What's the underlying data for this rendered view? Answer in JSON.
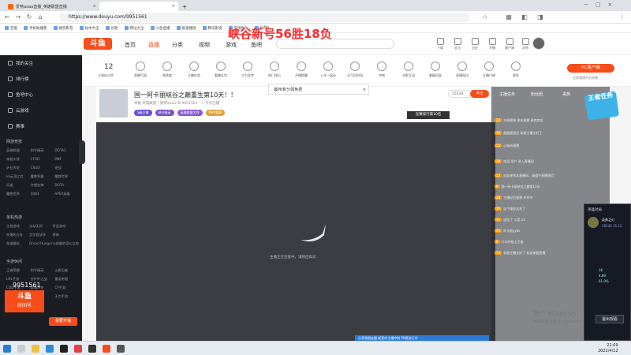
{
  "browser": {
    "tabs": [
      {
        "title": "爱特aoaa直播_英雄联盟直播",
        "active": false
      },
      {
        "title": "",
        "active": true
      }
    ],
    "new_tab": "+",
    "url": "https://www.douyu.com/9951561",
    "bookmarks": [
      "百度",
      "手机助播客",
      "搜狗影音",
      "站中大全",
      "谷歌",
      "网址大全",
      "斗鱼直播",
      "极速播放",
      "腾讯影视",
      "在线图片",
      "kaMa"
    ]
  },
  "overlay_title": "峡谷新号56胜18负",
  "site": {
    "logo": "斗鱼",
    "nav": [
      "首页",
      "直播",
      "分类",
      "视频",
      "游戏",
      "鱼吧"
    ],
    "nav_active": "直播",
    "header_icons": [
      "下载",
      "关注",
      "历史",
      "开播",
      "客户端",
      "消息",
      "会员中心"
    ]
  },
  "sidebar": {
    "top_items": [
      "我的关注",
      "排行榜",
      "鱼吧中心",
      "云游戏",
      "赛事"
    ],
    "section_games": "网游竞技",
    "games_grid": [
      "英雄联盟",
      "和平精英",
      "DOTA2",
      "穿越火线",
      "CFHD",
      "DNF",
      "炉石传说",
      "CSGO",
      "逆战",
      "lol云顶之弈",
      "魔兽争霸",
      "魔兽世界",
      "问道",
      "守望先锋",
      "DOTA",
      "魔兽世界",
      "剑网3",
      "APEX英雄"
    ],
    "section_single": "单机热游",
    "single_grid": [
      "主机游戏",
      "永劫无间",
      "怀旧游戏",
      "失落的方舟",
      "艾尔登法环",
      "原神",
      "车道模拟",
      "Dread Hunger",
      "小缇娜的奇幻之地"
    ],
    "section_mobile": "手游休闲",
    "mobile_grid": [
      "王者荣耀",
      "和平精英",
      "火影忍者",
      "LOL手游",
      "金铲铲之战",
      "重返帝国",
      "COD手游",
      "部落冲突",
      "CF手游",
      "街机人物王",
      "原神",
      "天刀手游"
    ],
    "logo_text": "斗鱼",
    "logo_sub": "房间号",
    "room_number": "9951561",
    "open_btn": "我要开播"
  },
  "category_bar": {
    "count": "12",
    "count_label": "主播粉丝牌",
    "items": [
      "直播气氛",
      "熟悉度",
      "主播任务",
      "看播礼包",
      "大力宣传",
      "热门排行",
      "开播提醒",
      "上车一起玩",
      "天气风时间",
      "冲刺",
      "光影互动",
      "掌握回复",
      "直播周边",
      "主播口碑",
      "更多"
    ],
    "pc_button": "PC客户端",
    "pc_sub": "全屏看播开启直播"
  },
  "room": {
    "title": "国一阿卡丽峡谷之巅重生第10天！！",
    "meta": "举报  英雄联盟  |  爱特aoaa  ID:9951561  ·  ✓ 今天已播",
    "tags": [
      "S级主播",
      "峡谷精英",
      "英雄联盟大师",
      "MVP竞赛"
    ],
    "pk_popup": "最PK积分领免费",
    "follow_count": "15534",
    "follow_label": "关注",
    "rank_badge": "竞赛排行第10名"
  },
  "player": {
    "loading_text": "主播正在连接中，请稍后再试",
    "bottom_banner": "分享到朋友圈 新签约主播冲刺 PK赛进行中"
  },
  "chat": {
    "tabs": [
      "主播任务",
      "粉丝团",
      "贵族"
    ],
    "slogan": "王者任务",
    "lines": [
      {
        "lv": "22",
        "text": "本周榜单  排名周期  贵宾席位"
      },
      {
        "lv": "18",
        "text": "超级管理员  恭喜主播太好了"
      },
      {
        "lv": "15",
        "text": "心城市直播"
      },
      {
        "lv": "30",
        "text": "欢迎 用户 进入直播间"
      },
      {
        "lv": "12",
        "text": "欢迎来到本直播间，请遵守直播规范"
      },
      {
        "lv": "9",
        "text": "国一阿卡丽峡谷之巅第10天"
      },
      {
        "lv": "20",
        "text": "主播好厉害啊 冲冲冲"
      },
      {
        "lv": "16",
        "text": "这个操作太秀了"
      },
      {
        "lv": "11",
        "text": "送出了 火箭 x1"
      },
      {
        "lv": "25",
        "text": "阿卡丽yyds"
      },
      {
        "lv": "8",
        "text": "什么时候上王者"
      },
      {
        "lv": "14",
        "text": "恭喜主播太好了 欢迎来看直播"
      }
    ]
  },
  "game_panel": {
    "title": "英雄对局",
    "hero_name": "英勇之刃",
    "hero_stats": "19143  15  12",
    "stats": [
      "16",
      "4.89",
      "61.0%"
    ],
    "exit_btn": "退出观看"
  },
  "windows": {
    "watermark": "激活 Windows",
    "watermark_sub": "转到设置以激活 Windows。",
    "time": "22:09",
    "date": "2022/4/12"
  },
  "colors": {
    "brand": "#f74d19",
    "sidebar": "#1b1d22",
    "player": "#3b3d42",
    "overlay_title": "#ff2a2a"
  }
}
